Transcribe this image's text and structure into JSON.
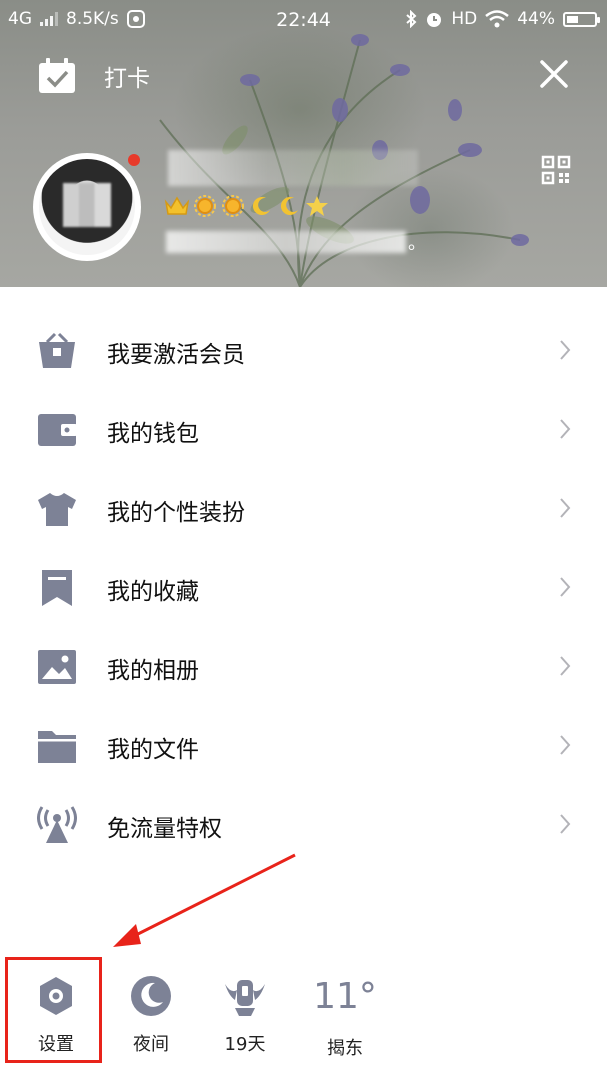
{
  "status_bar": {
    "network": "4G",
    "speed": "8.5K/s",
    "time": "22:44",
    "hd": "HD",
    "battery_text": "44%",
    "battery_level": 0.44
  },
  "header": {
    "checkin_label": "打卡",
    "signature_end": "。"
  },
  "menu": {
    "items": [
      {
        "label": "我要激活会员"
      },
      {
        "label": "我的钱包"
      },
      {
        "label": "我的个性装扮"
      },
      {
        "label": "我的收藏"
      },
      {
        "label": "我的相册"
      },
      {
        "label": "我的文件"
      },
      {
        "label": "免流量特权"
      }
    ]
  },
  "bottom_bar": {
    "settings_label": "设置",
    "night_label": "夜间",
    "days_label": "19天",
    "weather_temp": "11°",
    "weather_city": "揭东"
  },
  "colors": {
    "icon_gray": "#7d8296",
    "chevron": "#b3b3b8",
    "highlight_red": "#e8231a",
    "red_dot": "#e83a2a"
  }
}
